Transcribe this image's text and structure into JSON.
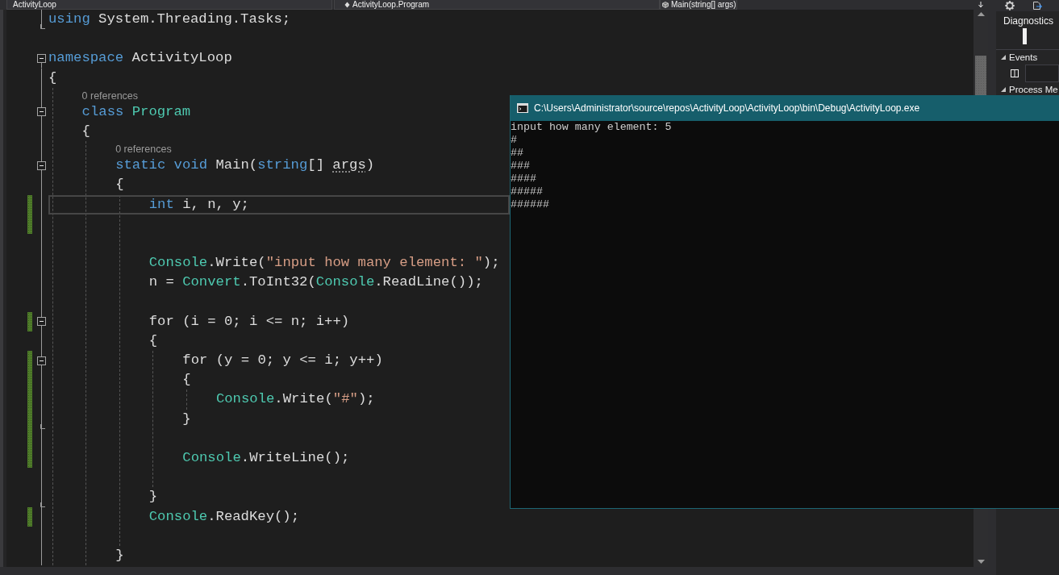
{
  "navigation_bar": [
    {
      "kind": "project",
      "label": "ActivityLoop"
    },
    {
      "kind": "type",
      "label": "ActivityLoop.Program"
    },
    {
      "kind": "member",
      "label": "Main(string[] args)"
    }
  ],
  "code": [
    {
      "kind": "code",
      "tokens": [
        {
          "text": "using",
          "kind": "keyword"
        },
        {
          "text": " System.Threading.Tasks;",
          "kind": "plain"
        }
      ],
      "fold_end": true
    },
    {
      "kind": "blank"
    },
    {
      "kind": "code",
      "tokens": [
        {
          "text": "namespace",
          "kind": "keyword"
        },
        {
          "text": " ActivityLoop",
          "kind": "plain"
        }
      ],
      "collapsible": true
    },
    {
      "kind": "code",
      "tokens": [
        {
          "text": "{",
          "kind": "plain"
        }
      ],
      "children": [
        {
          "kind": "code",
          "lens": "0 references",
          "tokens": [
            {
              "text": "class ",
              "kind": "keyword"
            },
            {
              "text": "Program",
              "kind": "type"
            }
          ],
          "collapsible": true
        },
        {
          "kind": "code",
          "tokens": [
            {
              "text": "{",
              "kind": "plain"
            }
          ],
          "children": [
            {
              "kind": "code",
              "lens": "0 references",
              "tokens": [
                {
                  "text": "static void ",
                  "kind": "keyword"
                },
                {
                  "text": "Main(",
                  "kind": "plain"
                },
                {
                  "text": "string",
                  "kind": "keyword"
                },
                {
                  "text": "[] ",
                  "kind": "plain"
                },
                {
                  "text": "args",
                  "kind": "unused"
                },
                {
                  "text": ")",
                  "kind": "plain"
                }
              ],
              "collapsible": true
            },
            {
              "kind": "code",
              "tokens": [
                {
                  "text": "{",
                  "kind": "plain"
                }
              ],
              "children": [
                {
                  "kind": "code",
                  "tokens": [
                    {
                      "text": "int",
                      "kind": "keyword"
                    },
                    {
                      "text": " i, n, y;",
                      "kind": "plain"
                    }
                  ],
                  "changed": true,
                  "current": true
                },
                {
                  "kind": "blank",
                  "changed": true
                },
                {
                  "kind": "blank"
                },
                {
                  "kind": "code",
                  "tokens": [
                    {
                      "text": "Console",
                      "kind": "type"
                    },
                    {
                      "text": ".Write(",
                      "kind": "plain"
                    },
                    {
                      "text": "\"input how many element: \"",
                      "kind": "string"
                    },
                    {
                      "text": ");",
                      "kind": "plain"
                    }
                  ]
                },
                {
                  "kind": "code",
                  "tokens": [
                    {
                      "text": "n = ",
                      "kind": "plain"
                    },
                    {
                      "text": "Convert",
                      "kind": "type"
                    },
                    {
                      "text": ".ToInt32(",
                      "kind": "plain"
                    },
                    {
                      "text": "Console",
                      "kind": "type"
                    },
                    {
                      "text": ".ReadLine());",
                      "kind": "plain"
                    }
                  ]
                },
                {
                  "kind": "blank"
                },
                {
                  "kind": "code",
                  "tokens": [
                    {
                      "text": "for (i = 0; i <= n; i++)",
                      "kind": "plain"
                    }
                  ],
                  "collapsible": true,
                  "changed": true
                },
                {
                  "kind": "code",
                  "tokens": [
                    {
                      "text": "{",
                      "kind": "plain"
                    }
                  ],
                  "children": [
                    {
                      "kind": "code",
                      "tokens": [
                        {
                          "text": "for (y = 0; y <= i; y++)",
                          "kind": "plain"
                        }
                      ],
                      "collapsible": true,
                      "changed": true
                    },
                    {
                      "kind": "code",
                      "tokens": [
                        {
                          "text": "{",
                          "kind": "plain"
                        }
                      ],
                      "changed": true,
                      "children": [
                        {
                          "kind": "code",
                          "tokens": [
                            {
                              "text": "Console",
                              "kind": "type"
                            },
                            {
                              "text": ".Write(",
                              "kind": "plain"
                            },
                            {
                              "text": "\"#\"",
                              "kind": "string"
                            },
                            {
                              "text": ");",
                              "kind": "plain"
                            }
                          ],
                          "changed": true
                        }
                      ]
                    },
                    {
                      "kind": "code",
                      "tokens": [
                        {
                          "text": "}",
                          "kind": "plain"
                        }
                      ],
                      "fold_end": true,
                      "changed": true
                    },
                    {
                      "kind": "blank",
                      "changed": true
                    },
                    {
                      "kind": "code",
                      "tokens": [
                        {
                          "text": "Console",
                          "kind": "type"
                        },
                        {
                          "text": ".WriteLine();",
                          "kind": "plain"
                        }
                      ],
                      "changed": true
                    },
                    {
                      "kind": "blank"
                    }
                  ]
                },
                {
                  "kind": "code",
                  "tokens": [
                    {
                      "text": "}",
                      "kind": "plain"
                    }
                  ],
                  "fold_end": true
                },
                {
                  "kind": "code",
                  "tokens": [
                    {
                      "text": "Console",
                      "kind": "type"
                    },
                    {
                      "text": ".ReadKey();",
                      "kind": "plain"
                    }
                  ],
                  "changed": true
                },
                {
                  "kind": "blank"
                }
              ]
            },
            {
              "kind": "code",
              "tokens": [
                {
                  "text": "}",
                  "kind": "plain"
                }
              ]
            }
          ]
        }
      ]
    }
  ],
  "console": {
    "title": "C:\\Users\\Administrator\\source\\repos\\ActivityLoop\\ActivityLoop\\bin\\Debug\\ActivityLoop.exe",
    "lines": [
      "input how many element: 5",
      "#",
      "##",
      "###",
      "####",
      "#####",
      "######"
    ]
  },
  "diagnostics_panel": {
    "title": "Diagnostics",
    "sections": [
      {
        "label": "Events",
        "expanded": true
      },
      {
        "label": "Process Me",
        "expanded": true
      }
    ]
  }
}
